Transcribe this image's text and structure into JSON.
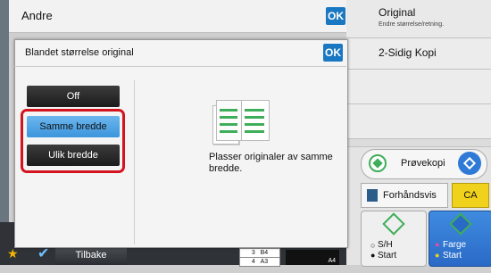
{
  "top_bar": {
    "title": "Andre",
    "ok_label": "OK"
  },
  "dialog": {
    "title": "Blandet størrelse original",
    "ok_label": "OK",
    "options": [
      {
        "label": "Off",
        "selected": false
      },
      {
        "label": "Samme bredde",
        "selected": true
      },
      {
        "label": "Ulik bredde",
        "selected": false
      }
    ],
    "description": "Plasser originaler av samme bredde."
  },
  "right_panel": {
    "original_title": "Original",
    "original_sub": "Endre størrelse/retning.",
    "duplex_label": "2-Sidig Kopi",
    "preview_copy_label": "Prøvekopi",
    "preview_label": "Forhåndsvis",
    "ca_label": "CA",
    "bw_start_line1": "S/H",
    "bw_start_line2": "Start",
    "color_start_line1": "Farge",
    "color_start_line2": "Start"
  },
  "bottom_bar": {
    "back_label": "Tilbake",
    "trays": [
      {
        "num": "3",
        "size": "B4"
      },
      {
        "num": "4",
        "size": "A3"
      }
    ],
    "paper_size": "A4"
  },
  "colors": {
    "accent_blue": "#1a78c2",
    "highlight_red": "#d3141f",
    "ca_yellow": "#f0d21c",
    "start_green": "#3fae5a",
    "color_start_blue": "#2f7ad6"
  }
}
